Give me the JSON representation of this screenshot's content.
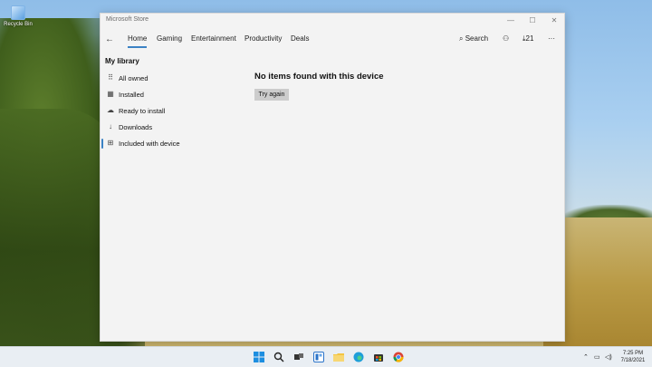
{
  "desktop": {
    "recycle_bin_label": "Recycle Bin"
  },
  "window": {
    "title": "Microsoft Store",
    "controls": {
      "minimize": "—",
      "maximize": "☐",
      "close": "✕"
    }
  },
  "nav": {
    "back": "←",
    "tabs": [
      "Home",
      "Gaming",
      "Entertainment",
      "Productivity",
      "Deals"
    ],
    "active_tab": "Home",
    "search_label": "Search",
    "downloads_count": "21",
    "more": "···"
  },
  "library": {
    "title": "My library",
    "items": [
      {
        "label": "All owned",
        "icon": "grid-icon"
      },
      {
        "label": "Installed",
        "icon": "installed-icon"
      },
      {
        "label": "Ready to install",
        "icon": "cloud-icon"
      },
      {
        "label": "Downloads",
        "icon": "download-icon"
      },
      {
        "label": "Included with device",
        "icon": "gift-icon"
      }
    ],
    "selected_item": "Included with device"
  },
  "main": {
    "empty_message": "No items found with this device",
    "retry_label": "Try again"
  },
  "taskbar": {
    "apps": [
      "windows-icon",
      "search-icon",
      "task-view-icon",
      "widgets-icon",
      "file-explorer-icon",
      "edge-icon",
      "store-icon",
      "chrome-icon"
    ],
    "time": "7:25 PM",
    "date": "7/18/2021"
  },
  "colors": {
    "accent": "#3b82c4",
    "window_bg": "#f3f3f3",
    "button_bg": "#cccccc"
  }
}
